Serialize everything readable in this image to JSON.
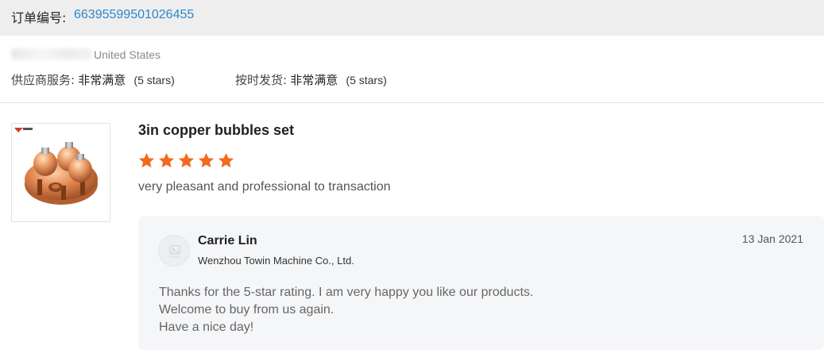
{
  "order": {
    "label": "订单编号:",
    "number": "66395599501026455"
  },
  "buyer": {
    "country": "United States"
  },
  "ratings": {
    "supplier_service": {
      "label": "供应商服务:",
      "value": "非常满意",
      "stars_text": "(5 stars)"
    },
    "on_time_shipping": {
      "label": "按时发货:",
      "value": "非常满意",
      "stars_text": "(5 stars)"
    }
  },
  "product": {
    "image_icon": "copper-bubbles-product-image",
    "title": "3in copper bubbles set",
    "rating": 5,
    "review": "very pleasant and professional to transaction"
  },
  "reply": {
    "seller_name": "Carrie Lin",
    "seller_company": "Wenzhou Towin Machine Co., Ltd.",
    "date": "13 Jan 2021",
    "lines": [
      "Thanks for the 5-star rating. I am very happy you like our products.",
      "Welcome to buy from us again.",
      "Have a nice day!"
    ]
  },
  "colors": {
    "link_blue": "#2f86c8",
    "star_orange": "#f26a1b",
    "header_bg": "#eeeeee",
    "reply_bg": "#f5f6f8"
  }
}
